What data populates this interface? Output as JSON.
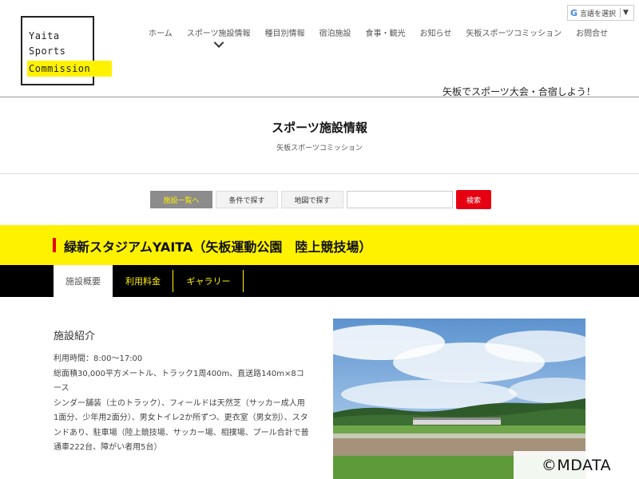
{
  "logo": {
    "line1": "Yaita",
    "line2": "Sports",
    "line3": "Commission"
  },
  "nav": {
    "items": [
      "ホーム",
      "スポーツ施設情報",
      "種目別情報",
      "宿泊施設",
      "食事・観光",
      "お知らせ",
      "矢板スポーツコミッション",
      "お問合せ"
    ]
  },
  "translate": {
    "g": "G",
    "label": "言語を選択",
    "arrow": "▼"
  },
  "tagline": "矢板でスポーツ大会・合宿しよう！",
  "page": {
    "title": "スポーツ施設情報",
    "subtitle": "矢板スポーツコミッション"
  },
  "search": {
    "list_label": "施設一覧へ",
    "cond_label": "条件で探す",
    "map_label": "地図で探す",
    "input_value": "",
    "submit_label": "検索"
  },
  "facility": {
    "name": "緑新スタジアムYAITA（矢板運動公園　陸上競技場）"
  },
  "tabs": [
    "施設概要",
    "利用料金",
    "ギャラリー"
  ],
  "intro": {
    "heading": "施設紹介",
    "hours": "利用時間：8:00〜17:00",
    "area": "総面積30,000平方メートル、トラック1周400m、直送路140m×8コース",
    "details": "シンダー舗装（土のトラック）、フィールドは天然芝（サッカー成人用1面分、少年用2面分）、男女トイレ2か所ずつ、更衣室（男女別）、スタンドあり、駐車場（陸上競技場、サッカー場、相撲場、プール合計で普通車222台、障がい者用5台）"
  },
  "watermark": "©MDATA",
  "colors": {
    "accent_yellow": "#fff200",
    "accent_red": "#e60012",
    "tab_bar": "#000000"
  }
}
